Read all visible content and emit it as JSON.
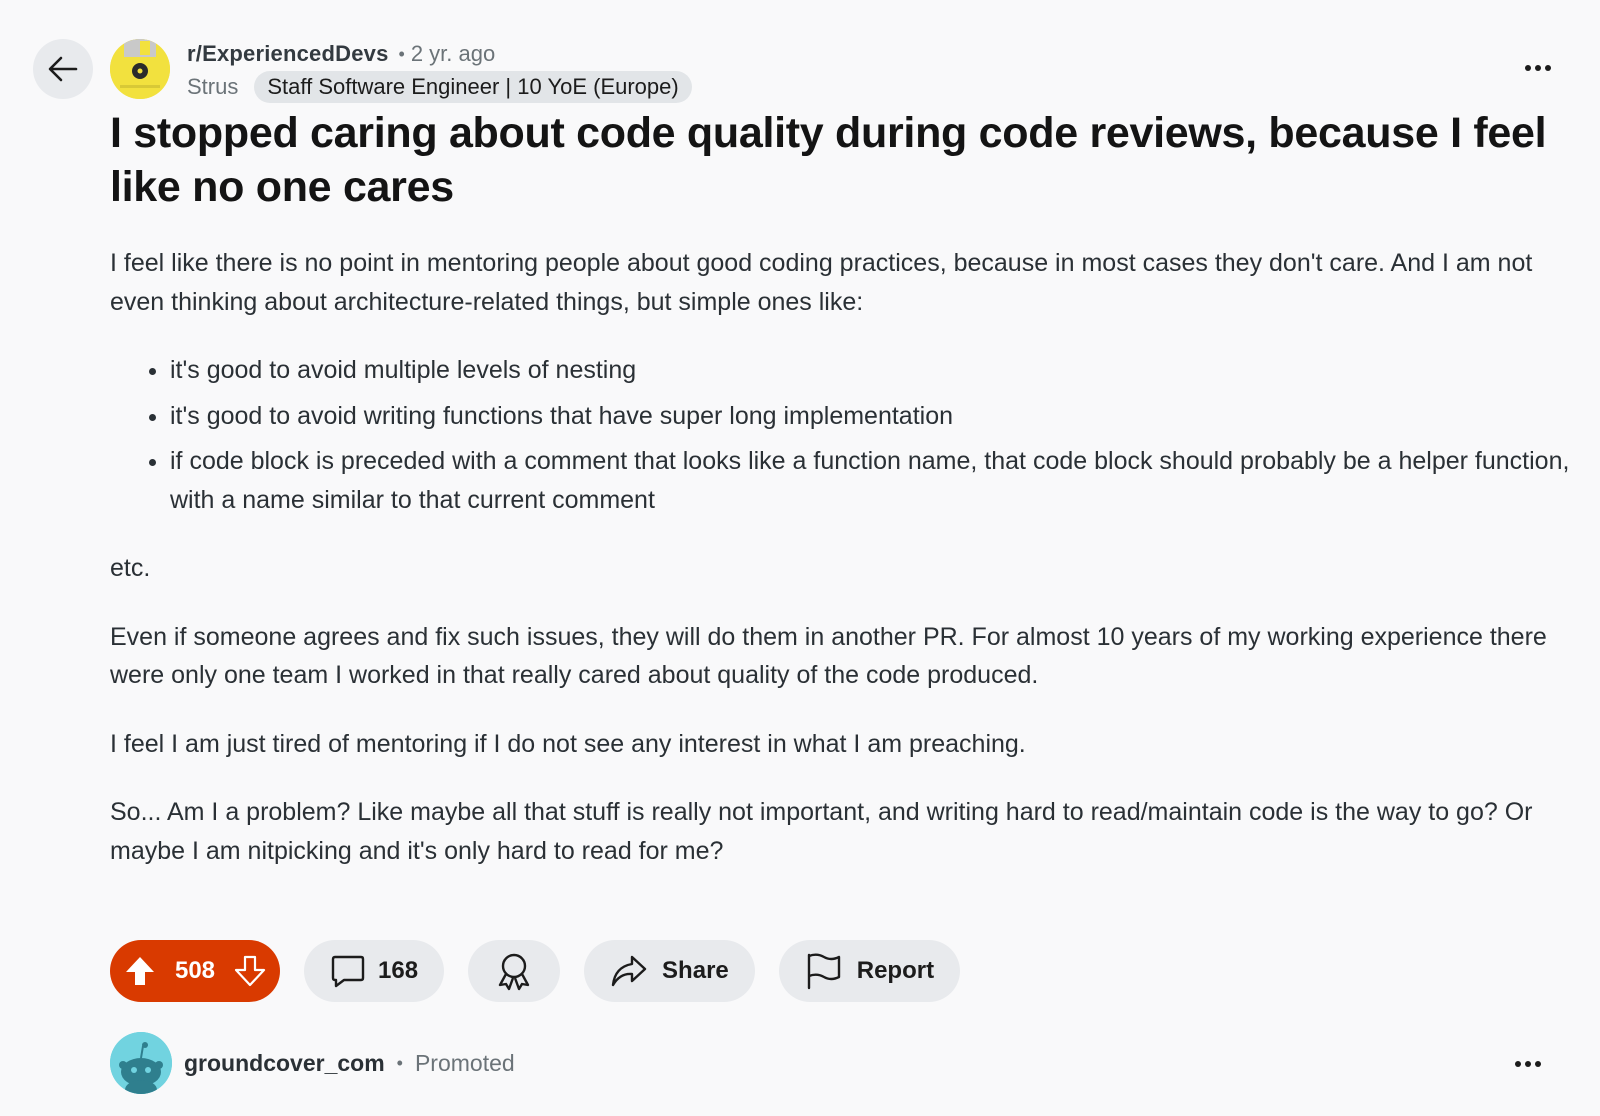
{
  "header": {
    "subreddit": "r/ExperiencedDevs",
    "separator": "•",
    "time_ago": "2 yr. ago",
    "author": "Strus",
    "flair": "Staff Software Engineer | 10 YoE (Europe)"
  },
  "post": {
    "title": "I stopped caring about code quality during code reviews, because I feel like no one cares",
    "paragraph_1": "I feel like there is no point in mentoring people about good coding practices, because in most cases they don't care. And I am not even thinking about architecture-related things, but simple ones like:",
    "bullets": [
      "it's good to avoid multiple levels of nesting",
      "it's good to avoid writing functions that have super long implementation",
      "if code block is preceded with a comment that looks like a function name, that code block should probably be a helper function, with a name similar to that current comment"
    ],
    "paragraph_2": "etc.",
    "paragraph_3": "Even if someone agrees and fix such issues, they will do them in another PR. For almost 10 years of my working experience there were only one team I worked in that really cared about quality of the code produced.",
    "paragraph_4": "I feel I am just tired of mentoring if I do not see any interest in what I am preaching.",
    "paragraph_5": "So... Am I a problem? Like maybe all that stuff is really not important, and writing hard to read/maintain code is the way to go? Or maybe I am nitpicking and it's only hard to read for me?"
  },
  "actions": {
    "vote_count": "508",
    "comment_count": "168",
    "share_label": "Share",
    "report_label": "Report"
  },
  "promoted": {
    "name": "groundcover_com",
    "separator": "•",
    "label": "Promoted"
  },
  "colors": {
    "vote_active": "#d93a00",
    "pill_bg": "#e8eaed",
    "page_bg": "#f9f9fa"
  },
  "icons": [
    "back-arrow-icon",
    "more-icon",
    "upvote-icon",
    "downvote-icon",
    "comment-icon",
    "award-icon",
    "share-icon",
    "flag-icon"
  ]
}
